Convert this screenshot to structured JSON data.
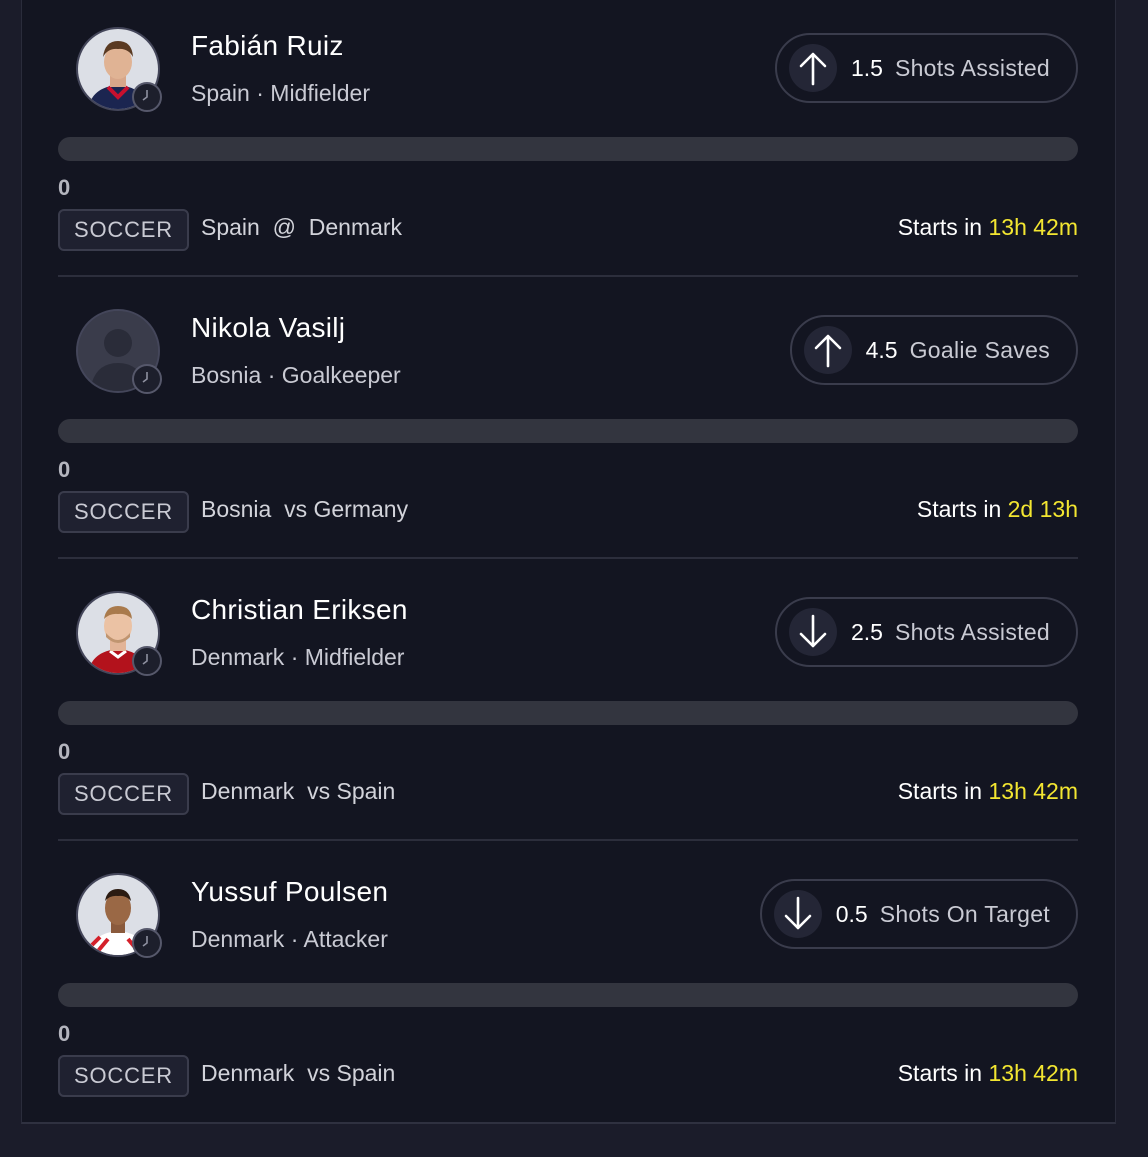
{
  "colors": {
    "background": "#131521",
    "countdown": "#f3e631",
    "progress_track": "#33353f",
    "border": "#3a3c4c"
  },
  "picks": [
    {
      "player_name": "Fabián Ruiz",
      "team": "Spain",
      "separator": "·",
      "position": "Midfielder",
      "direction_icon": "arrow-up-icon",
      "line": "1.5",
      "stat": "Shots Assisted",
      "progress": 0,
      "current_value": "0",
      "sport": "SOCCER",
      "team_a": "Spain",
      "connector": "@",
      "team_b": "Denmark",
      "starts_label": "Starts in",
      "countdown": "13h 42m"
    },
    {
      "player_name": "Nikola Vasilj",
      "team": "Bosnia",
      "separator": "·",
      "position": "Goalkeeper",
      "direction_icon": "arrow-up-icon",
      "line": "4.5",
      "stat": "Goalie Saves",
      "progress": 0,
      "current_value": "0",
      "sport": "SOCCER",
      "team_a": "Bosnia",
      "connector": "vs",
      "team_b": "Germany",
      "starts_label": "Starts in",
      "countdown": "2d 13h"
    },
    {
      "player_name": "Christian Eriksen",
      "team": "Denmark",
      "separator": "·",
      "position": "Midfielder",
      "direction_icon": "arrow-down-icon",
      "line": "2.5",
      "stat": "Shots Assisted",
      "progress": 0,
      "current_value": "0",
      "sport": "SOCCER",
      "team_a": "Denmark",
      "connector": "vs",
      "team_b": "Spain",
      "starts_label": "Starts in",
      "countdown": "13h 42m"
    },
    {
      "player_name": "Yussuf Poulsen",
      "team": "Denmark",
      "separator": "·",
      "position": "Attacker",
      "direction_icon": "arrow-down-icon",
      "line": "0.5",
      "stat": "Shots On Target",
      "progress": 0,
      "current_value": "0",
      "sport": "SOCCER",
      "team_a": "Denmark",
      "connector": "vs",
      "team_b": "Spain",
      "starts_label": "Starts in",
      "countdown": "13h 42m"
    }
  ]
}
